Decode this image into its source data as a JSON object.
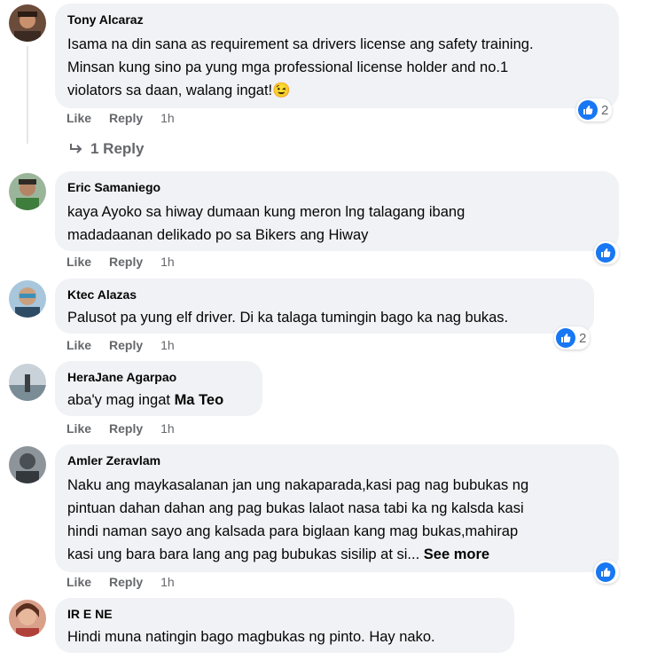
{
  "comments": [
    {
      "author": "Tony Alcaraz",
      "lines": "Isama na din sana as requirement sa drivers license ang safety training.\nMinsan kung sino pa yung mga professional license holder and no.1\nviolators sa daan, walang ingat!",
      "emoji": "😉",
      "like": "Like",
      "reply": "Reply",
      "time": "1h",
      "reactions": "2",
      "replies_label": "1 Reply"
    },
    {
      "author": "Eric Samaniego",
      "lines": "kaya Ayoko sa hiway dumaan kung meron lng talagang ibang\nmadadaanan delikado po sa Bikers ang Hiway",
      "like": "Like",
      "reply": "Reply",
      "time": "1h",
      "reactions": ""
    },
    {
      "author": "Ktec Alazas",
      "lines": "Palusot pa yung elf driver. Di ka talaga tumingin bago ka nag bukas.",
      "like": "Like",
      "reply": "Reply",
      "time": "1h",
      "reactions": "2"
    },
    {
      "author": "HeraJane Agarpao",
      "lines_prefix": "aba'y mag ingat ",
      "mention": "Ma Teo",
      "like": "Like",
      "reply": "Reply",
      "time": "1h"
    },
    {
      "author": "Amler Zeravlam",
      "lines": "Naku ang maykasalanan jan ung nakaparada,kasi pag nag bubukas ng\npintuan dahan dahan ang pag bukas lalaot nasa tabi ka ng kalsda kasi\nhindi naman sayo ang kalsada para biglaan kang mag bukas,mahirap\nkasi ung bara bara lang ang pag bubukas sisilip at si... ",
      "see_more": "See more",
      "like": "Like",
      "reply": "Reply",
      "time": "1h",
      "reactions": ""
    },
    {
      "author": "IR E NE",
      "lines": "Hindi muna natingin bago magbukas ng pinto. Hay nako."
    }
  ],
  "colors": {
    "bubble": "#f0f2f5",
    "like_blue": "#1877f2",
    "meta": "#65676b"
  }
}
